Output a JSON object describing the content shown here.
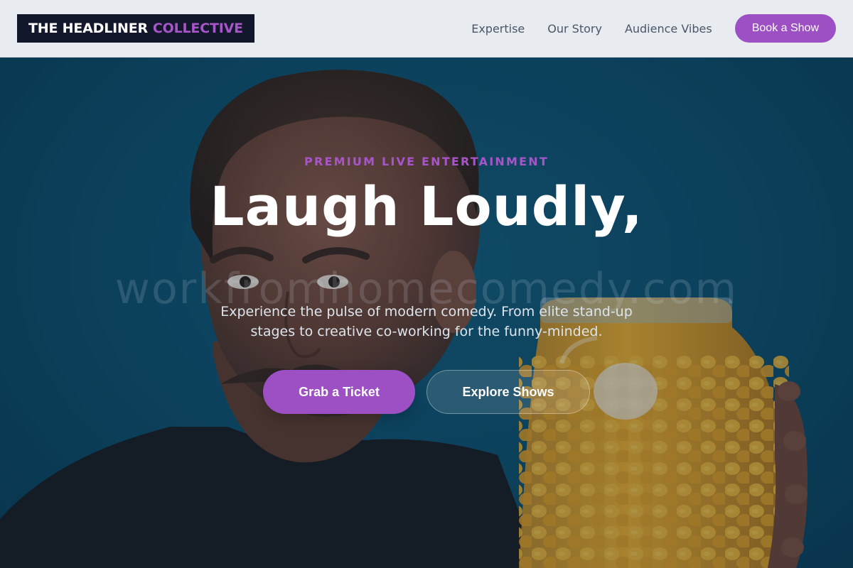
{
  "brand": {
    "name_part1": "THE HEADLINER",
    "name_part2": "COLLECTIVE"
  },
  "nav": {
    "links": [
      "Expertise",
      "Our Story",
      "Audience Vibes"
    ],
    "cta_label": "Book a Show"
  },
  "hero": {
    "eyebrow": "PREMIUM LIVE ENTERTAINMENT",
    "headline": "Laugh Loudly,",
    "subtitle": "Experience the pulse of modern comedy. From elite stand-up stages to creative co-working for the funny-minded.",
    "watermark": "workfromhomecomedy.com",
    "primary_button": "Grab a Ticket",
    "secondary_button": "Explore Shows",
    "image": "man-with-jar-of-cheese-puffs"
  },
  "colors": {
    "accent": "#9d4fc4",
    "accent_text": "#a855c9",
    "header_bg": "#e8ecf0",
    "logo_bg": "#12172c",
    "hero_bg": "#0e4e6c"
  }
}
